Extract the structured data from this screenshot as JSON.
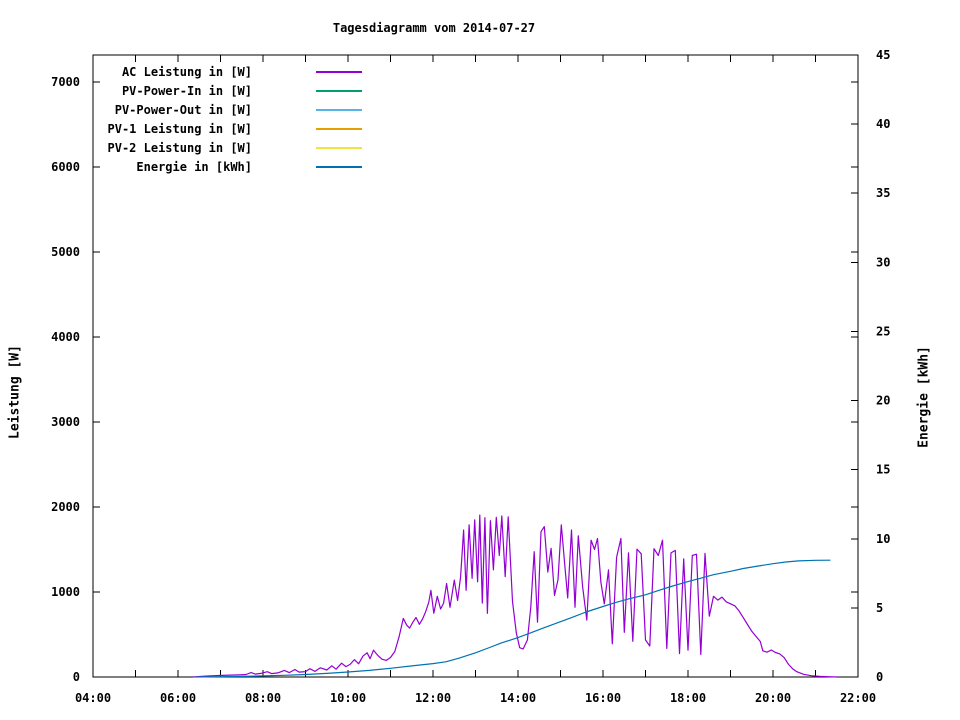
{
  "title": "Tagesdiagramm vom 2014-07-27",
  "axis_labels": {
    "left": "Leistung [W]",
    "right": "Energie [kWh]"
  },
  "colors": {
    "background": "#ffffff",
    "axis": "#000000",
    "ac": "#9400d3",
    "pv_power_in": "#009e73",
    "pv_power_out": "#56b4e9",
    "pv1": "#e69f00",
    "pv2": "#f0e442",
    "energie": "#0072b2"
  },
  "legend": {
    "items": [
      {
        "label": "AC Leistung in [W]",
        "color": "#9400d3"
      },
      {
        "label": "PV-Power-In in [W]",
        "color": "#009e73"
      },
      {
        "label": "PV-Power-Out in [W]",
        "color": "#56b4e9"
      },
      {
        "label": "PV-1 Leistung in [W]",
        "color": "#e69f00"
      },
      {
        "label": "PV-2 Leistung in [W]",
        "color": "#f0e442"
      },
      {
        "label": "Energie in [kWh]",
        "color": "#0072b2"
      }
    ]
  },
  "chart_data": {
    "type": "line",
    "title": "Tagesdiagramm vom 2014-07-27",
    "grid": false,
    "legend_position": "inside-top-left",
    "x_axis": {
      "kind": "time-of-day",
      "range_hours": [
        4,
        22
      ],
      "tick_every_hours": 1,
      "label_every_hours": 2,
      "tick_labels": [
        "04:00",
        "06:00",
        "08:00",
        "10:00",
        "12:00",
        "14:00",
        "16:00",
        "18:00",
        "20:00",
        "22:00"
      ]
    },
    "y_left_axis": {
      "label": "Leistung [W]",
      "range": [
        0,
        7320
      ],
      "ticks": [
        0,
        1000,
        2000,
        3000,
        4000,
        5000,
        6000,
        7000
      ]
    },
    "y_right_axis": {
      "label": "Energie [kWh]",
      "range": [
        0,
        45
      ],
      "ticks": [
        0,
        5,
        10,
        15,
        20,
        25,
        30,
        35,
        40,
        45
      ]
    },
    "series": [
      {
        "name": "AC Leistung in [W]",
        "color": "#9400d3",
        "y_axis": "left",
        "visible": true,
        "points_hour_value": [
          [
            6.35,
            0
          ],
          [
            6.6,
            10
          ],
          [
            6.9,
            16
          ],
          [
            7.2,
            22
          ],
          [
            7.45,
            26
          ],
          [
            7.6,
            30
          ],
          [
            7.72,
            52
          ],
          [
            7.82,
            34
          ],
          [
            7.95,
            42
          ],
          [
            8.1,
            62
          ],
          [
            8.2,
            40
          ],
          [
            8.35,
            48
          ],
          [
            8.5,
            78
          ],
          [
            8.62,
            52
          ],
          [
            8.75,
            88
          ],
          [
            8.85,
            58
          ],
          [
            9.0,
            64
          ],
          [
            9.1,
            98
          ],
          [
            9.22,
            66
          ],
          [
            9.35,
            108
          ],
          [
            9.5,
            82
          ],
          [
            9.62,
            132
          ],
          [
            9.72,
            92
          ],
          [
            9.85,
            162
          ],
          [
            9.95,
            122
          ],
          [
            10.05,
            148
          ],
          [
            10.15,
            205
          ],
          [
            10.25,
            155
          ],
          [
            10.35,
            245
          ],
          [
            10.45,
            285
          ],
          [
            10.52,
            215
          ],
          [
            10.6,
            315
          ],
          [
            10.7,
            255
          ],
          [
            10.8,
            210
          ],
          [
            10.9,
            195
          ],
          [
            11.0,
            230
          ],
          [
            11.1,
            300
          ],
          [
            11.2,
            470
          ],
          [
            11.3,
            690
          ],
          [
            11.38,
            610
          ],
          [
            11.45,
            575
          ],
          [
            11.52,
            640
          ],
          [
            11.6,
            700
          ],
          [
            11.68,
            620
          ],
          [
            11.75,
            680
          ],
          [
            11.82,
            760
          ],
          [
            11.9,
            880
          ],
          [
            11.95,
            1020
          ],
          [
            12.02,
            750
          ],
          [
            12.1,
            950
          ],
          [
            12.18,
            800
          ],
          [
            12.25,
            870
          ],
          [
            12.32,
            1100
          ],
          [
            12.4,
            820
          ],
          [
            12.5,
            1140
          ],
          [
            12.58,
            900
          ],
          [
            12.65,
            1180
          ],
          [
            12.72,
            1730
          ],
          [
            12.78,
            1020
          ],
          [
            12.85,
            1790
          ],
          [
            12.92,
            1160
          ],
          [
            12.98,
            1850
          ],
          [
            13.05,
            1120
          ],
          [
            13.1,
            1905
          ],
          [
            13.16,
            870
          ],
          [
            13.22,
            1875
          ],
          [
            13.28,
            750
          ],
          [
            13.35,
            1840
          ],
          [
            13.42,
            1260
          ],
          [
            13.49,
            1880
          ],
          [
            13.56,
            1430
          ],
          [
            13.62,
            1895
          ],
          [
            13.7,
            1180
          ],
          [
            13.77,
            1885
          ],
          [
            13.87,
            890
          ],
          [
            13.96,
            520
          ],
          [
            14.04,
            345
          ],
          [
            14.12,
            330
          ],
          [
            14.22,
            435
          ],
          [
            14.3,
            825
          ],
          [
            14.38,
            1475
          ],
          [
            14.46,
            645
          ],
          [
            14.54,
            1710
          ],
          [
            14.62,
            1770
          ],
          [
            14.7,
            1235
          ],
          [
            14.78,
            1515
          ],
          [
            14.86,
            960
          ],
          [
            14.94,
            1145
          ],
          [
            15.02,
            1790
          ],
          [
            15.1,
            1315
          ],
          [
            15.17,
            930
          ],
          [
            15.26,
            1730
          ],
          [
            15.34,
            820
          ],
          [
            15.42,
            1660
          ],
          [
            15.52,
            1065
          ],
          [
            15.62,
            670
          ],
          [
            15.72,
            1610
          ],
          [
            15.8,
            1500
          ],
          [
            15.87,
            1630
          ],
          [
            15.95,
            1115
          ],
          [
            16.03,
            860
          ],
          [
            16.13,
            1260
          ],
          [
            16.22,
            390
          ],
          [
            16.32,
            1410
          ],
          [
            16.42,
            1630
          ],
          [
            16.5,
            525
          ],
          [
            16.6,
            1460
          ],
          [
            16.7,
            420
          ],
          [
            16.8,
            1505
          ],
          [
            16.9,
            1450
          ],
          [
            17.0,
            435
          ],
          [
            17.1,
            365
          ],
          [
            17.2,
            1510
          ],
          [
            17.3,
            1430
          ],
          [
            17.4,
            1610
          ],
          [
            17.5,
            335
          ],
          [
            17.6,
            1460
          ],
          [
            17.7,
            1490
          ],
          [
            17.8,
            275
          ],
          [
            17.9,
            1390
          ],
          [
            18.0,
            315
          ],
          [
            18.1,
            1430
          ],
          [
            18.2,
            1445
          ],
          [
            18.3,
            265
          ],
          [
            18.4,
            1455
          ],
          [
            18.5,
            715
          ],
          [
            18.6,
            950
          ],
          [
            18.7,
            905
          ],
          [
            18.8,
            940
          ],
          [
            18.9,
            885
          ],
          [
            19.0,
            862
          ],
          [
            19.1,
            838
          ],
          [
            19.2,
            778
          ],
          [
            19.3,
            698
          ],
          [
            19.4,
            618
          ],
          [
            19.5,
            538
          ],
          [
            19.6,
            478
          ],
          [
            19.7,
            418
          ],
          [
            19.76,
            308
          ],
          [
            19.86,
            292
          ],
          [
            19.96,
            318
          ],
          [
            20.06,
            288
          ],
          [
            20.16,
            272
          ],
          [
            20.26,
            228
          ],
          [
            20.36,
            152
          ],
          [
            20.46,
            98
          ],
          [
            20.56,
            62
          ],
          [
            20.72,
            32
          ],
          [
            20.9,
            15
          ],
          [
            21.1,
            8
          ],
          [
            21.3,
            4
          ],
          [
            21.5,
            0
          ]
        ]
      },
      {
        "name": "PV-Power-In in [W]",
        "color": "#009e73",
        "y_axis": "left",
        "visible": false,
        "points_hour_value": []
      },
      {
        "name": "PV-Power-Out in [W]",
        "color": "#56b4e9",
        "y_axis": "left",
        "visible": false,
        "points_hour_value": []
      },
      {
        "name": "PV-1 Leistung in [W]",
        "color": "#e69f00",
        "y_axis": "left",
        "visible": false,
        "points_hour_value": []
      },
      {
        "name": "PV-2 Leistung in [W]",
        "color": "#f0e442",
        "y_axis": "left",
        "visible": false,
        "points_hour_value": []
      },
      {
        "name": "Energie in [kWh]",
        "color": "#0072b2",
        "y_axis": "right",
        "visible": true,
        "points_hour_value": [
          [
            6.4,
            0
          ],
          [
            7.0,
            0.02
          ],
          [
            7.5,
            0.04
          ],
          [
            8.0,
            0.08
          ],
          [
            8.5,
            0.12
          ],
          [
            9.0,
            0.18
          ],
          [
            9.5,
            0.26
          ],
          [
            10.0,
            0.36
          ],
          [
            10.5,
            0.48
          ],
          [
            11.0,
            0.63
          ],
          [
            11.5,
            0.8
          ],
          [
            12.0,
            0.97
          ],
          [
            12.3,
            1.1
          ],
          [
            12.6,
            1.35
          ],
          [
            13.0,
            1.75
          ],
          [
            13.3,
            2.1
          ],
          [
            13.6,
            2.45
          ],
          [
            14.0,
            2.85
          ],
          [
            14.3,
            3.2
          ],
          [
            14.6,
            3.55
          ],
          [
            15.0,
            4.0
          ],
          [
            15.3,
            4.35
          ],
          [
            15.6,
            4.7
          ],
          [
            16.0,
            5.1
          ],
          [
            16.3,
            5.4
          ],
          [
            16.6,
            5.65
          ],
          [
            17.0,
            5.95
          ],
          [
            17.3,
            6.25
          ],
          [
            17.6,
            6.55
          ],
          [
            18.0,
            6.9
          ],
          [
            18.3,
            7.15
          ],
          [
            18.6,
            7.4
          ],
          [
            19.0,
            7.65
          ],
          [
            19.3,
            7.85
          ],
          [
            19.6,
            8.0
          ],
          [
            20.0,
            8.2
          ],
          [
            20.3,
            8.32
          ],
          [
            20.6,
            8.4
          ],
          [
            21.0,
            8.44
          ],
          [
            21.35,
            8.45
          ]
        ]
      }
    ]
  }
}
